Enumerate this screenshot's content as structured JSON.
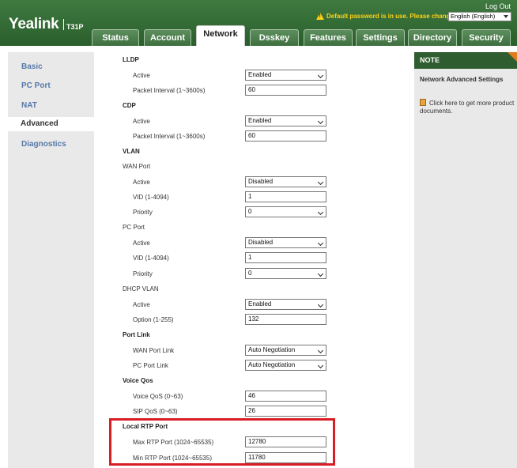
{
  "header": {
    "brand": "Yealink",
    "model": "T31P",
    "logout": "Log Out",
    "warning": "Default password is in use. Please change!",
    "language": "English (English)"
  },
  "tabs": [
    "Status",
    "Account",
    "Network",
    "Dsskey",
    "Features",
    "Settings",
    "Directory",
    "Security"
  ],
  "active_tab": "Network",
  "leftnav": [
    "Basic",
    "PC Port",
    "NAT",
    "Advanced",
    "Diagnostics"
  ],
  "form": {
    "lldp": {
      "title": "LLDP",
      "active_label": "Active",
      "active_value": "Enabled",
      "interval_label": "Packet Interval (1~3600s)",
      "interval_value": "60"
    },
    "cdp": {
      "title": "CDP",
      "active_label": "Active",
      "active_value": "Enabled",
      "interval_label": "Packet Interval (1~3600s)",
      "interval_value": "60"
    },
    "vlan": {
      "title": "VLAN",
      "wan_title": "WAN Port",
      "wan_active_label": "Active",
      "wan_active_value": "Disabled",
      "wan_vid_label": "VID (1-4094)",
      "wan_vid_value": "1",
      "wan_priority_label": "Priority",
      "wan_priority_value": "0",
      "pc_title": "PC Port",
      "pc_active_label": "Active",
      "pc_active_value": "Disabled",
      "pc_vid_label": "VID (1-4094)",
      "pc_vid_value": "1",
      "pc_priority_label": "Priority",
      "pc_priority_value": "0",
      "dhcp_title": "DHCP VLAN",
      "dhcp_active_label": "Active",
      "dhcp_active_value": "Enabled",
      "dhcp_option_label": "Option (1-255)",
      "dhcp_option_value": "132"
    },
    "portlink": {
      "title": "Port Link",
      "wan_label": "WAN Port Link",
      "wan_value": "Auto Negotiation",
      "pc_label": "PC Port Link",
      "pc_value": "Auto Negotiation"
    },
    "qos": {
      "title": "Voice Qos",
      "voice_label": "Voice QoS (0~63)",
      "voice_value": "46",
      "sip_label": "SIP QoS (0~63)",
      "sip_value": "26"
    },
    "rtp": {
      "title": "Local RTP Port",
      "max_label": "Max RTP Port (1024~65535)",
      "max_value": "12780",
      "min_label": "Min RTP Port (1024~65535)",
      "min_value": "11780"
    }
  },
  "note": {
    "heading": "NOTE",
    "title": "Network Advanced Settings",
    "body": "Click here to get more product documents."
  },
  "colors": {
    "header_green": "#2a5e2c",
    "nav_link": "#5679a8",
    "highlight": "#d81e25",
    "warning": "#ffd21a",
    "note_corner": "#e07b20"
  }
}
